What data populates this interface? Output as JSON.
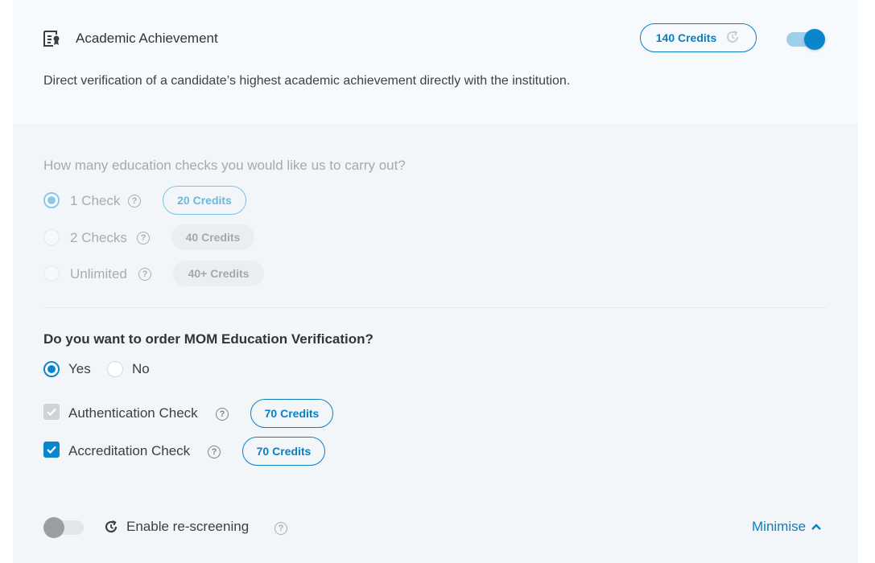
{
  "header": {
    "title": "Academic Achievement",
    "description": "Direct verification of a candidate’s highest academic achievement directly with the institution.",
    "credits": "140 Credits",
    "enabled": true
  },
  "education_checks": {
    "question": "How many education checks you would like us to carry out?",
    "options": [
      {
        "label": "1 Check",
        "credits": "20 Credits",
        "selected": true
      },
      {
        "label": "2 Checks",
        "credits": "40 Credits",
        "selected": false
      },
      {
        "label": "Unlimited",
        "credits": "40+ Credits",
        "selected": false
      }
    ]
  },
  "mom": {
    "question": "Do you want to order MOM Education Verification?",
    "yes_label": "Yes",
    "no_label": "No",
    "selected": "Yes",
    "checks": [
      {
        "label": "Authentication Check",
        "credits": "70 Credits",
        "checked": true,
        "disabled": true
      },
      {
        "label": "Accreditation Check",
        "credits": "70 Credits",
        "checked": true,
        "disabled": false
      }
    ]
  },
  "footer": {
    "rescreening_label": "Enable re-screening",
    "rescreening_enabled": false,
    "minimise_label": "Minimise"
  },
  "colors": {
    "accent": "#0a86cc",
    "background": "#f3f6f9"
  },
  "help_glyph": "?"
}
